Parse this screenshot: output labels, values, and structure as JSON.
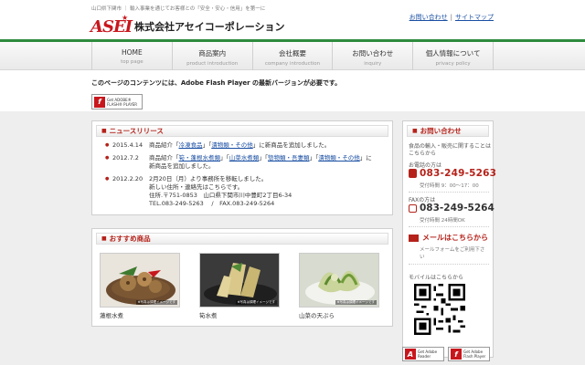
{
  "header": {
    "tagline": "山口県下関市 ｜ 輸入事業を通じてお客様との「安全・安心・信用」を第一に",
    "logo_text": "ASEI",
    "company_name": "株式会社アセイコーポレーション",
    "links": [
      {
        "label": "お問い合わせ"
      },
      {
        "label": "サイトマップ"
      }
    ],
    "separator": "|"
  },
  "nav": [
    {
      "jp": "HOME",
      "en": "top page"
    },
    {
      "jp": "商品案内",
      "en": "product introduction"
    },
    {
      "jp": "会社概要",
      "en": "company introduction"
    },
    {
      "jp": "お問い合わせ",
      "en": "inquiry"
    },
    {
      "jp": "個人情報について",
      "en": "privacy policy"
    }
  ],
  "flash_notice": "このページのコンテンツには、Adobe Flash Player の最新バージョンが必要です。",
  "flash_badge": {
    "line1": "Get ADOBE®",
    "line2": "FLASH® PLAYER",
    "logo": "f"
  },
  "news": {
    "title": "ニュースリリース",
    "items": [
      {
        "date": "2015.4.14",
        "prefix": "商品紹介「",
        "links": [
          "冷凍食品"
        ],
        "middle": "」「",
        "links2": [
          "漬物類・その他"
        ],
        "suffix": "」に新商品を追加しました。"
      },
      {
        "date": "2012.7.2",
        "line1_prefix": "商品紹介「",
        "link_a": "筍・蓬根水煮類",
        "sep1": "」「",
        "link_b": "山菜水煮類",
        "sep2": "」「",
        "link_c": "惣物類・吾妻類",
        "sep3": "」「",
        "link_d": "漬物類・その他",
        "line1_suffix": "」に",
        "line2": "新商品を追加しました。"
      },
      {
        "date": "2012.2.20",
        "lines": [
          "2月20日（月）より事務所を移転しました。",
          "新しい住所・連絡先はこちらです。",
          "住所.〒751-0853　山口県下関市川中豊町2丁目6-34",
          "TEL.083-249-5263　 /　FAX.083-249-5264"
        ]
      }
    ]
  },
  "recommend": {
    "title": "おすすめ商品",
    "image_caption": "※写真は調理イメージです",
    "products": [
      {
        "name": "蓮根水煮"
      },
      {
        "name": "筍水煮"
      },
      {
        "name": "山菜の天ぷら"
      }
    ]
  },
  "sidebar": {
    "title": "お問い合わせ",
    "intro": [
      "食品の輸入・販売に関することは",
      "こちらから"
    ],
    "phone_label": "お電話の方は",
    "phone": "083-249-5263",
    "phone_hours": "受付時間 9：00～17：00",
    "fax_label": "FAXの方は",
    "fax": "083-249-5264",
    "fax_hours": "受付時間 24時間OK",
    "mail_label": "メールはこちらから",
    "mail_sub": [
      "メールフォームをご利用下さ",
      "い"
    ],
    "mobile_label": "モバイルはこちらから"
  },
  "bottom_badges": [
    {
      "line1": "Get Adobe",
      "line2": "Reader"
    },
    {
      "line1": "Get Adobe",
      "line2": "Flash Player"
    }
  ],
  "colors": {
    "accent_red": "#b5221a",
    "logo_red": "#c8161d",
    "header_green": "#2e8b3d",
    "link_blue": "#1a4fa3"
  }
}
